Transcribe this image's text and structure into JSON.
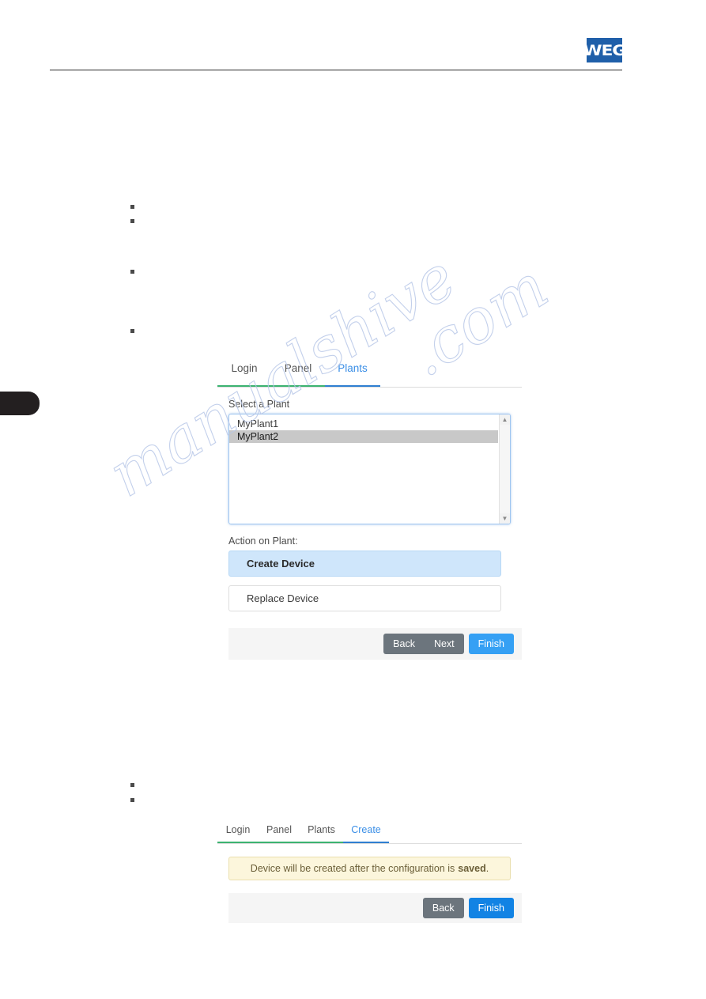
{
  "brand": {
    "logo_text": "WEG",
    "logo_color": "#1f5fa9"
  },
  "watermark": {
    "line1": "manualshive",
    "line2": ".com"
  },
  "figure1": {
    "tabs": [
      {
        "label": "Login",
        "state": "done"
      },
      {
        "label": "Panel",
        "state": "done"
      },
      {
        "label": "Plants",
        "state": "active"
      }
    ],
    "select_plant_label": "Select a Plant",
    "plants": [
      {
        "name": "MyPlant1",
        "selected": false
      },
      {
        "name": "MyPlant2",
        "selected": true
      }
    ],
    "scroll_up_icon": "▲",
    "scroll_down_icon": "▼",
    "action_label": "Action on Plant:",
    "actions": [
      {
        "label": "Create Device",
        "selected": true
      },
      {
        "label": "Replace Device",
        "selected": false
      }
    ],
    "buttons": {
      "back": "Back",
      "next": "Next",
      "finish": "Finish"
    }
  },
  "figure2": {
    "tabs": [
      {
        "label": "Login",
        "state": "done"
      },
      {
        "label": "Panel",
        "state": "done"
      },
      {
        "label": "Plants",
        "state": "done"
      },
      {
        "label": "Create",
        "state": "active"
      }
    ],
    "alert_text": "Device will be created after the configuration is",
    "alert_strong": "saved",
    "alert_suffix": ".",
    "buttons": {
      "back": "Back",
      "finish": "Finish"
    }
  }
}
